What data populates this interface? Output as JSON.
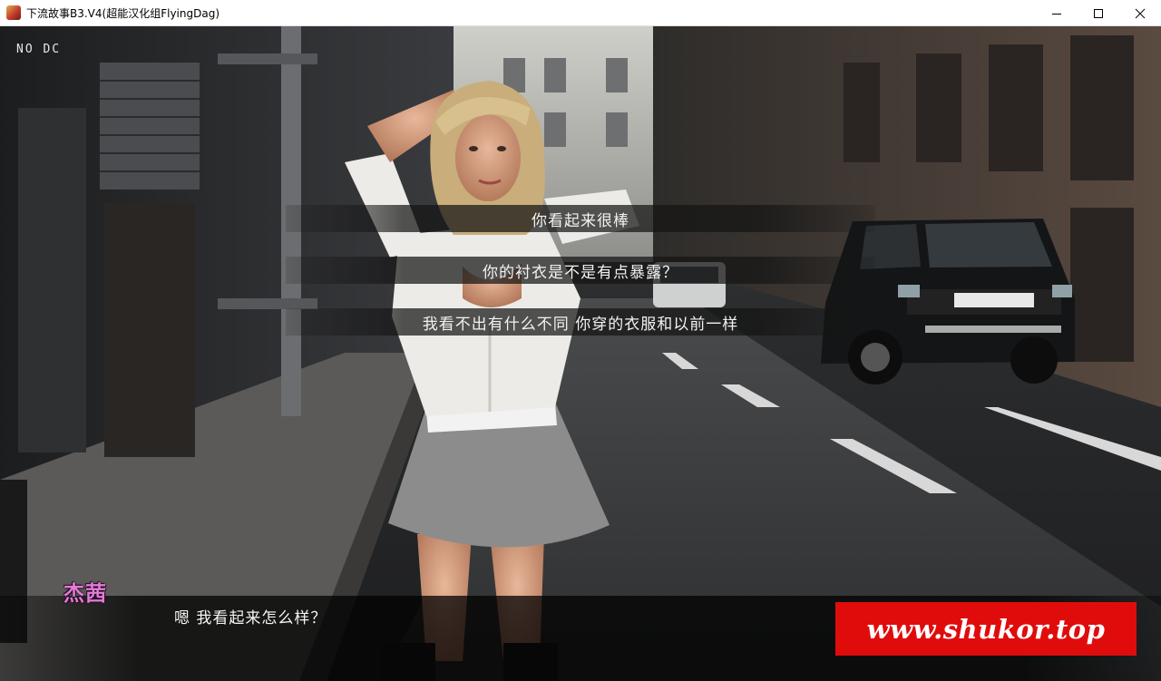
{
  "window": {
    "title": "下流故事B3.V4(超能汉化组FlyingDag)",
    "icon": "game-app-icon",
    "controls": {
      "minimize": "minimize-icon",
      "maximize": "maximize-icon",
      "close": "close-icon"
    }
  },
  "hud": {
    "corner_label": "NO DC"
  },
  "menu": {
    "choices": [
      {
        "label": "你看起来很棒"
      },
      {
        "label": "你的衬衣是不是有点暴露？"
      },
      {
        "label": "我看不出有什么不同 你穿的衣服和以前一样"
      }
    ]
  },
  "dialogue": {
    "speaker": "杰茜",
    "speaker_color": "#e27bd6",
    "text": "嗯 我看起来怎么样？"
  },
  "watermark": {
    "text": "www.shukor.top",
    "color": "#e00c0c"
  }
}
